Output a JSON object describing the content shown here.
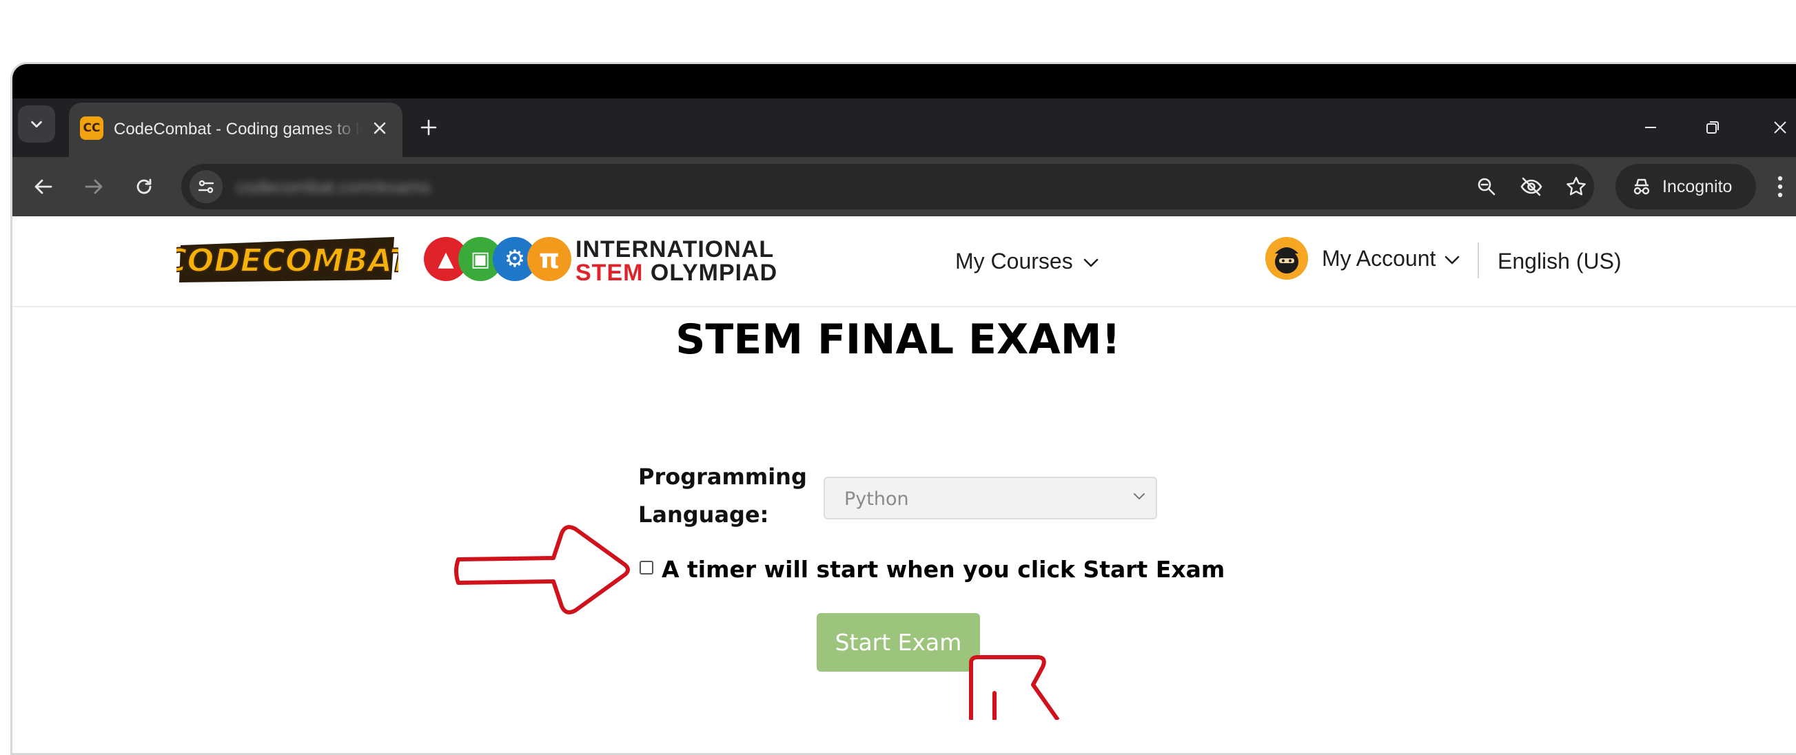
{
  "browser": {
    "tab_title": "CodeCombat - Coding games to learn Python",
    "url": "codecombat.com/exams",
    "incognito_label": "Incognito"
  },
  "site_header": {
    "stem_line1": "INTERNATIONAL",
    "stem_line2_word1": "STEM",
    "stem_line2_word2": "OLYMPIAD",
    "nav_my_courses": "My Courses",
    "nav_my_account": "My Account",
    "nav_language": "English (US)"
  },
  "exam": {
    "title": "STEM FINAL EXAM!",
    "programming_language_label": "Programming Language:",
    "selected_language": "Python",
    "timer_checkbox_label": "A timer will start when you click Start Exam",
    "timer_checkbox_checked": false,
    "start_button_label": "Start Exam"
  },
  "colors": {
    "start_button_bg": "#9dc47d",
    "annotation_red": "#d0121d",
    "stem_red": "#e0222a",
    "stem_green": "#3aaa3a",
    "stem_blue": "#1f77c9",
    "stem_orange": "#f39a1c"
  },
  "icons": {
    "tab_dropdown": "chevron-down-icon",
    "close_tab": "close-icon",
    "new_tab": "plus-icon",
    "back": "arrow-left-icon",
    "forward": "arrow-right-icon",
    "reload": "reload-icon",
    "site_info": "tune-icon",
    "zoom": "zoom-out-icon",
    "tracking": "eye-off-icon",
    "bookmark": "star-icon",
    "incognito": "incognito-icon",
    "menu": "kebab-menu-icon"
  }
}
